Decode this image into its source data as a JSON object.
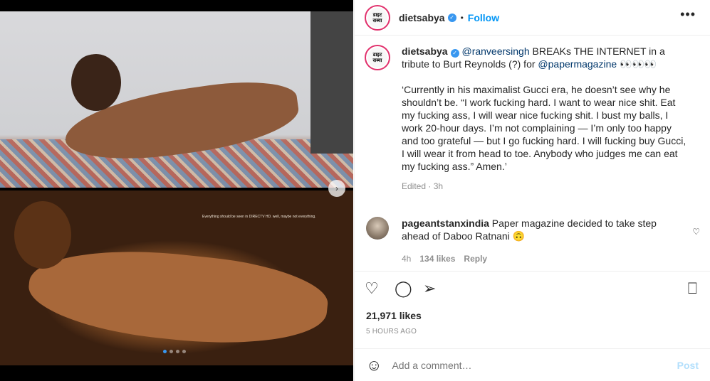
{
  "media": {
    "caption_text": "Everything should be seen in DIRECTV HD.      well, maybe not everything.",
    "next_glyph": "›",
    "dots": [
      true,
      false,
      false,
      false
    ]
  },
  "header": {
    "avatar_text_1": "डाइट",
    "avatar_text_2": "सब्या",
    "username": "dietsabya",
    "separator": "•",
    "follow_label": "Follow",
    "more_glyph": "•••"
  },
  "post": {
    "username": "dietsabya",
    "mention1": "@ranveersingh",
    "text1": " BREAKs THE INTERNET in a tribute to Burt Reynolds (?) for ",
    "mention2": "@papermagazine",
    "emoji": " 👀👀👀",
    "quote": "‘Currently in his maximalist Gucci era, he doesn’t see why he shouldn’t be. “I work fucking hard. I want to wear nice shit. Eat my fucking ass, I will wear nice fucking shit. I bust my balls, I work 20-hour days. I’m not complaining — I’m only too happy and too grateful — but I go fucking hard. I will fucking buy Gucci, I will wear it from head to toe. Anybody who judges me can eat my fucking ass.” Amen.’",
    "meta": "Edited · 3h"
  },
  "comment": {
    "username": "pageantstanxindia",
    "text": " Paper magazine decided to take step ahead of Daboo Ratnani 🙃",
    "time": "4h",
    "likes": "134 likes",
    "reply": "Reply"
  },
  "actions": {
    "likes": "21,971 likes",
    "time": "5 HOURS AGO"
  },
  "add_comment": {
    "placeholder": "Add a comment…",
    "post_label": "Post"
  }
}
